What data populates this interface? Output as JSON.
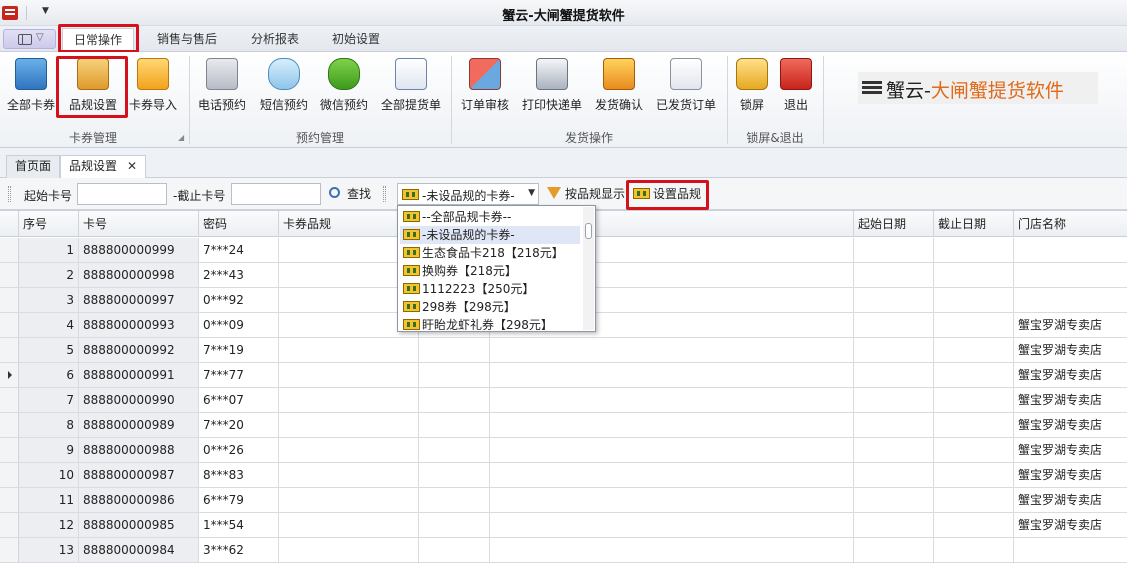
{
  "window": {
    "title": "蟹云-大闸蟹提货软件"
  },
  "ribbon_tabs": [
    {
      "label": "日常操作",
      "active": true
    },
    {
      "label": "销售与售后",
      "active": false
    },
    {
      "label": "分析报表",
      "active": false
    },
    {
      "label": "初始设置",
      "active": false
    }
  ],
  "ribbon_groups": [
    {
      "label": "卡券管理",
      "buttons": [
        {
          "label": "全部卡券",
          "icon": "cards-icon"
        },
        {
          "label": "品规设置",
          "icon": "card-spec-icon"
        },
        {
          "label": "卡券导入",
          "icon": "folder-import-icon"
        }
      ]
    },
    {
      "label": "预约管理",
      "buttons": [
        {
          "label": "电话预约",
          "icon": "phone-icon"
        },
        {
          "label": "短信预约",
          "icon": "chat-bubble-icon"
        },
        {
          "label": "微信预约",
          "icon": "wechat-icon"
        },
        {
          "label": "全部提货单",
          "icon": "calendar-icon"
        }
      ]
    },
    {
      "label": "发货操作",
      "buttons": [
        {
          "label": "订单审核",
          "icon": "eraser-icon"
        },
        {
          "label": "打印快递单",
          "icon": "printer-icon"
        },
        {
          "label": "发货确认",
          "icon": "truck-icon"
        },
        {
          "label": "已发货订单",
          "icon": "clipboard-check-icon"
        }
      ]
    },
    {
      "label": "锁屏&退出",
      "buttons": [
        {
          "label": "锁屏",
          "icon": "lock-icon"
        },
        {
          "label": "退出",
          "icon": "close-icon"
        }
      ]
    }
  ],
  "logo": {
    "part1": "蟹云-",
    "part2": "大闸蟹提货软件"
  },
  "doc_tabs": [
    {
      "label": "首页面"
    },
    {
      "label": "品规设置",
      "close": "✕"
    }
  ],
  "filter": {
    "start_label": "起始卡号",
    "end_label": "-截止卡号",
    "search_label": "查找",
    "combo_value": "-未设品规的卡券-",
    "show_by_spec_label": "按品规显示",
    "set_spec_label": "设置品规"
  },
  "dropdown_options": [
    "--全部品规卡券--",
    "-未设品规的卡券-",
    "生态食品卡218【218元】",
    "换购券【218元】",
    "1112223【250元】",
    "298券【298元】",
    "盱眙龙虾礼券【298元】"
  ],
  "grid": {
    "columns": [
      "序号",
      "卡号",
      "密码",
      "卡券品规",
      "起始日期",
      "截止日期",
      "门店名称"
    ],
    "rows": [
      {
        "seq": "1",
        "card": "888800000999",
        "pwd": "7***24",
        "store": ""
      },
      {
        "seq": "2",
        "card": "888800000998",
        "pwd": "2***43",
        "store": ""
      },
      {
        "seq": "3",
        "card": "888800000997",
        "pwd": "0***92",
        "store": ""
      },
      {
        "seq": "4",
        "card": "888800000993",
        "pwd": "0***09",
        "store": "蟹宝罗湖专卖店"
      },
      {
        "seq": "5",
        "card": "888800000992",
        "pwd": "7***19",
        "store": "蟹宝罗湖专卖店"
      },
      {
        "seq": "6",
        "card": "888800000991",
        "pwd": "7***77",
        "store": "蟹宝罗湖专卖店"
      },
      {
        "seq": "7",
        "card": "888800000990",
        "pwd": "6***07",
        "store": "蟹宝罗湖专卖店"
      },
      {
        "seq": "8",
        "card": "888800000989",
        "pwd": "7***20",
        "store": "蟹宝罗湖专卖店"
      },
      {
        "seq": "9",
        "card": "888800000988",
        "pwd": "0***26",
        "store": "蟹宝罗湖专卖店"
      },
      {
        "seq": "10",
        "card": "888800000987",
        "pwd": "8***83",
        "store": "蟹宝罗湖专卖店"
      },
      {
        "seq": "11",
        "card": "888800000986",
        "pwd": "6***79",
        "store": "蟹宝罗湖专卖店"
      },
      {
        "seq": "12",
        "card": "888800000985",
        "pwd": "1***54",
        "store": "蟹宝罗湖专卖店"
      },
      {
        "seq": "13",
        "card": "888800000984",
        "pwd": "3***62",
        "store": ""
      }
    ]
  }
}
